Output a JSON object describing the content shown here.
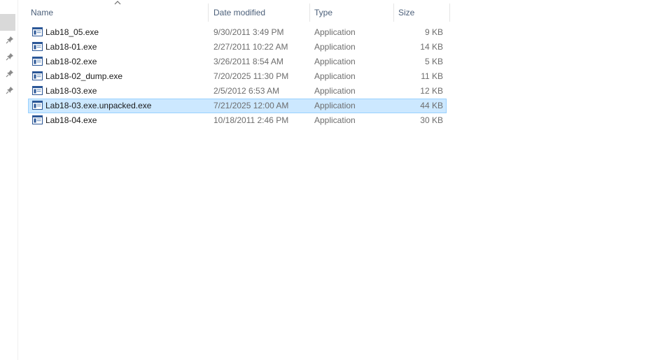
{
  "columns": {
    "name": "Name",
    "date": "Date modified",
    "type": "Type",
    "size": "Size"
  },
  "sort": {
    "column": "name",
    "direction": "ascending",
    "icon": "chevron-up-icon"
  },
  "nav_pins": [
    "pin-icon",
    "pin-icon",
    "pin-icon",
    "pin-icon"
  ],
  "colors": {
    "selection_bg": "#cce8ff",
    "selection_border": "#99d1ff",
    "header_text": "#4c607a",
    "meta_text": "#6d6d6d"
  },
  "files": [
    {
      "name": "Lab18_05.exe",
      "date": "9/30/2011 3:49 PM",
      "type": "Application",
      "size": "9 KB",
      "icon": "application-icon",
      "selected": false
    },
    {
      "name": "Lab18-01.exe",
      "date": "2/27/2011 10:22 AM",
      "type": "Application",
      "size": "14 KB",
      "icon": "application-icon",
      "selected": false
    },
    {
      "name": "Lab18-02.exe",
      "date": "3/26/2011 8:54 AM",
      "type": "Application",
      "size": "5 KB",
      "icon": "application-icon",
      "selected": false
    },
    {
      "name": "Lab18-02_dump.exe",
      "date": "7/20/2025 11:30 PM",
      "type": "Application",
      "size": "11 KB",
      "icon": "application-icon",
      "selected": false
    },
    {
      "name": "Lab18-03.exe",
      "date": "2/5/2012 6:53 AM",
      "type": "Application",
      "size": "12 KB",
      "icon": "application-icon",
      "selected": false
    },
    {
      "name": "Lab18-03.exe.unpacked.exe",
      "date": "7/21/2025 12:00 AM",
      "type": "Application",
      "size": "44 KB",
      "icon": "application-icon",
      "selected": true
    },
    {
      "name": "Lab18-04.exe",
      "date": "10/18/2011 2:46 PM",
      "type": "Application",
      "size": "30 KB",
      "icon": "application-icon",
      "selected": false
    }
  ]
}
